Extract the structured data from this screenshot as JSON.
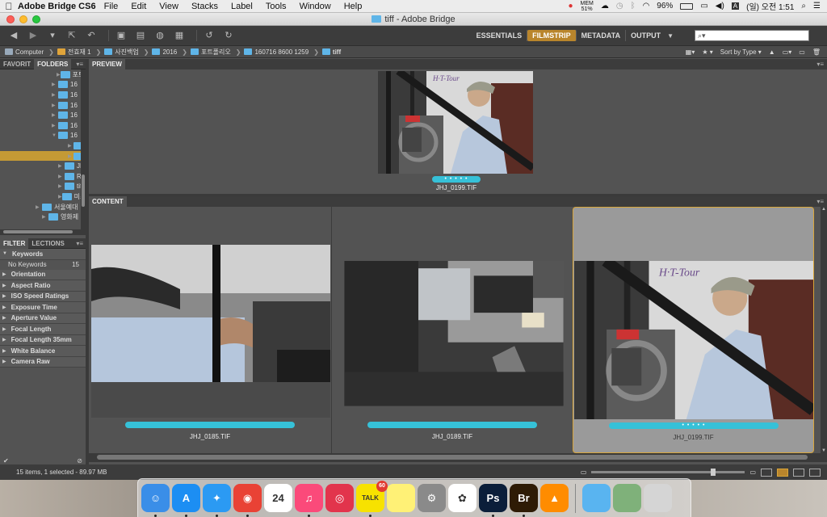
{
  "menubar": {
    "app_name": "Adobe Bridge CS6",
    "items": [
      "File",
      "Edit",
      "View",
      "Stacks",
      "Label",
      "Tools",
      "Window",
      "Help"
    ],
    "mem_label": "MEM",
    "mem_value": "51%",
    "battery": "96%",
    "clock": "(일) 오전 1:51"
  },
  "window": {
    "title": "tiff - Adobe Bridge"
  },
  "toolbar": {
    "workspaces": [
      "ESSENTIALS",
      "FILMSTRIP",
      "METADATA",
      "OUTPUT"
    ],
    "active_workspace": "FILMSTRIP",
    "search_placeholder": "",
    "sort_label": "Sort by Type"
  },
  "path": [
    {
      "label": "Computer"
    },
    {
      "label": "전효재 1"
    },
    {
      "label": "사진백업"
    },
    {
      "label": "2016"
    },
    {
      "label": "포트폴리오"
    },
    {
      "label": "160716 8600 1259"
    },
    {
      "label": "tiff"
    }
  ],
  "left_panel": {
    "tabs": [
      "FAVORIT",
      "FOLDERS"
    ],
    "folders": [
      {
        "label": "포트폴",
        "expanded": false,
        "selected": false
      },
      {
        "label": "16",
        "expanded": false,
        "selected": false
      },
      {
        "label": "16",
        "expanded": false,
        "selected": false
      },
      {
        "label": "16",
        "expanded": false,
        "selected": false
      },
      {
        "label": "16",
        "expanded": false,
        "selected": false
      },
      {
        "label": "16",
        "expanded": false,
        "selected": false
      },
      {
        "label": "16",
        "expanded": true,
        "selected": false
      },
      {
        "label": "",
        "expanded": false,
        "selected": false
      },
      {
        "label": "",
        "expanded": false,
        "selected": true
      },
      {
        "label": "JP",
        "expanded": false,
        "selected": false
      },
      {
        "label": "Ra",
        "expanded": false,
        "selected": false
      },
      {
        "label": "tiff",
        "expanded": false,
        "selected": false
      },
      {
        "label": "미소",
        "expanded": false,
        "selected": false
      },
      {
        "label": "서울예대 ",
        "expanded": false,
        "selected": false
      },
      {
        "label": "영화제",
        "expanded": false,
        "selected": false
      }
    ],
    "filter_tabs": [
      "FILTER",
      "LECTIONS"
    ],
    "filter_keywords_label": "Keywords",
    "filter_no_keywords": "No Keywords",
    "filter_no_keywords_count": "15",
    "filters": [
      "Orientation",
      "Aspect Ratio",
      "ISO Speed Ratings",
      "Exposure Time",
      "Aperture Value",
      "Focal Length",
      "Focal Length 35mm",
      "White Balance",
      "Camera Raw"
    ]
  },
  "preview": {
    "tab": "PREVIEW",
    "file": "JHJ_0199.TIF",
    "rating_dots": "• • • • •"
  },
  "content": {
    "tab": "CONTENT",
    "items": [
      {
        "file": "JHJ_0185.TIF",
        "selected": false
      },
      {
        "file": "JHJ_0189.TIF",
        "selected": false
      },
      {
        "file": "JHJ_0199.TIF",
        "selected": true
      }
    ],
    "rating_dots": "• • • • •"
  },
  "status": {
    "text": "15 items, 1 selected - 89.97 MB",
    "thumbnail_size": 0.8
  },
  "dock": {
    "apps": [
      {
        "name": "Finder",
        "color": "#3a8ee8",
        "glyph": "☺",
        "running": true
      },
      {
        "name": "App Store",
        "color": "#1c8ef3",
        "glyph": "A",
        "running": true
      },
      {
        "name": "Safari",
        "color": "#2b9af3",
        "glyph": "✦",
        "running": true
      },
      {
        "name": "Chrome",
        "color": "#e94235",
        "glyph": "◉",
        "running": true
      },
      {
        "name": "Calendar",
        "color": "#ffffff",
        "glyph": "24",
        "running": false
      },
      {
        "name": "iTunes",
        "color": "#fb4a7a",
        "glyph": "♫",
        "running": true
      },
      {
        "name": "Podcasts",
        "color": "#e2344c",
        "glyph": "◎",
        "running": false
      },
      {
        "name": "KakaoTalk",
        "color": "#f7e200",
        "glyph": "TALK",
        "running": true,
        "badge": "60"
      },
      {
        "name": "Stickies",
        "color": "#fff176",
        "glyph": "",
        "running": false
      },
      {
        "name": "Preferences",
        "color": "#8a8a8a",
        "glyph": "⚙",
        "running": false
      },
      {
        "name": "Photos",
        "color": "#ffffff",
        "glyph": "✿",
        "running": false
      },
      {
        "name": "Photoshop",
        "color": "#0b1e3a",
        "glyph": "Ps",
        "running": true
      },
      {
        "name": "Bridge",
        "color": "#2e1b05",
        "glyph": "Br",
        "running": true
      },
      {
        "name": "VLC",
        "color": "#ff8c00",
        "glyph": "▲",
        "running": false
      }
    ],
    "folders": [
      {
        "name": "Folder",
        "color": "#59b4f0"
      },
      {
        "name": "Preview",
        "color": "#7fb17a"
      },
      {
        "name": "Trash",
        "color": "#d5d5d5"
      }
    ]
  }
}
